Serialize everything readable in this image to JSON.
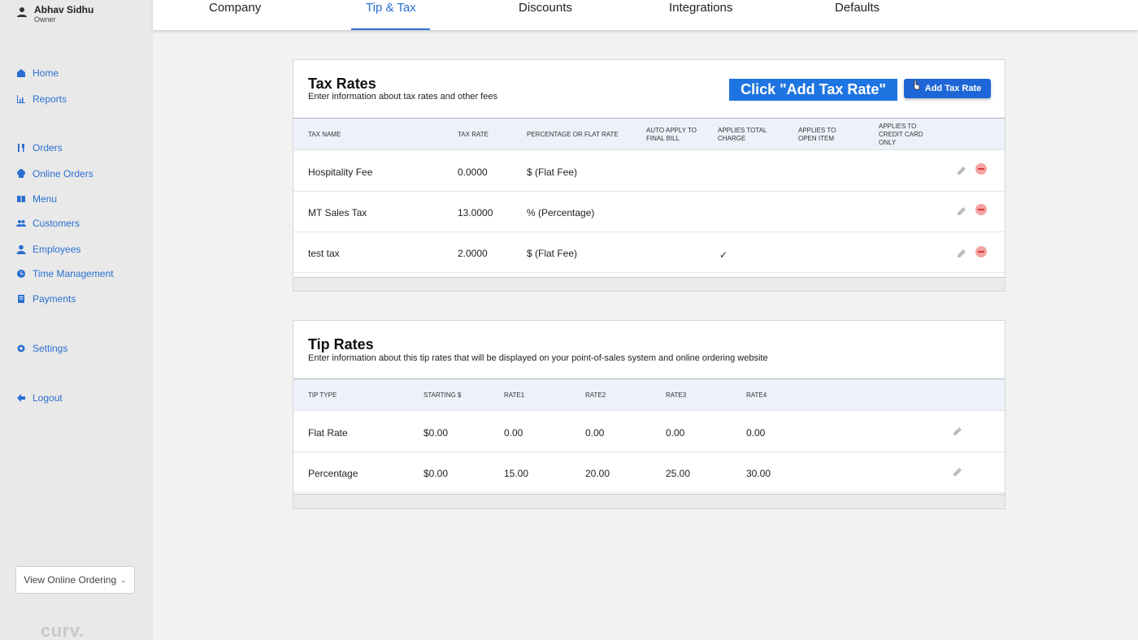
{
  "user": {
    "name": "Abhav Sidhu",
    "role": "Owner"
  },
  "sidebar": {
    "items": [
      {
        "label": "Home",
        "icon": "home-icon"
      },
      {
        "label": "Reports",
        "icon": "chart-icon"
      },
      {
        "label": "Orders",
        "icon": "utensils-icon"
      },
      {
        "label": "Online Orders",
        "icon": "chef-hat-icon"
      },
      {
        "label": "Menu",
        "icon": "book-icon"
      },
      {
        "label": "Customers",
        "icon": "people-icon"
      },
      {
        "label": "Employees",
        "icon": "person-icon"
      },
      {
        "label": "Time Management",
        "icon": "clock-icon"
      },
      {
        "label": "Payments",
        "icon": "receipt-icon"
      },
      {
        "label": "Settings",
        "icon": "gear-icon"
      },
      {
        "label": "Logout",
        "icon": "arrow-left-icon"
      }
    ],
    "view_online_label": "View Online Ordering",
    "logo": "curv."
  },
  "tabs": [
    "Company",
    "Tip & Tax",
    "Discounts",
    "Integrations",
    "Defaults"
  ],
  "active_tab": "Tip & Tax",
  "callout": "Click \"Add Tax Rate\"",
  "tax": {
    "title": "Tax Rates",
    "subtitle": "Enter information about tax rates and other fees",
    "add_label": "Add Tax Rate",
    "headers": [
      "TAX NAME",
      "TAX RATE",
      "PERCENTAGE OR FLAT RATE",
      "AUTO APPLY TO FINAL BILL",
      "APPLIES TOTAL CHARGE",
      "APPLIES TO OPEN ITEM",
      "APPLIES TO CREDIT CARD ONLY"
    ],
    "rows": [
      {
        "name": "Hospitality Fee",
        "rate": "0.0000",
        "type": "$ (Flat Fee)",
        "check": ""
      },
      {
        "name": "MT Sales Tax",
        "rate": "13.0000",
        "type": "% (Percentage)",
        "check": ""
      },
      {
        "name": "test tax",
        "rate": "2.0000",
        "type": "$ (Flat Fee)",
        "check": "✓"
      }
    ]
  },
  "tip": {
    "title": "Tip Rates",
    "subtitle": "Enter information about this tip rates that will be displayed on your point-of-sales system and online ordering website",
    "headers": [
      "TIP TYPE",
      "STARTING $",
      "RATE1",
      "RATE2",
      "RATE3",
      "RATE4"
    ],
    "rows": [
      {
        "type": "Flat Rate",
        "start": "$0.00",
        "r1": "0.00",
        "r2": "0.00",
        "r3": "0.00",
        "r4": "0.00"
      },
      {
        "type": "Percentage",
        "start": "$0.00",
        "r1": "15.00",
        "r2": "20.00",
        "r3": "25.00",
        "r4": "30.00"
      }
    ]
  },
  "colors": {
    "accent": "#1e66d8",
    "link": "#2a6fd1",
    "danger": "#d83a3a"
  }
}
